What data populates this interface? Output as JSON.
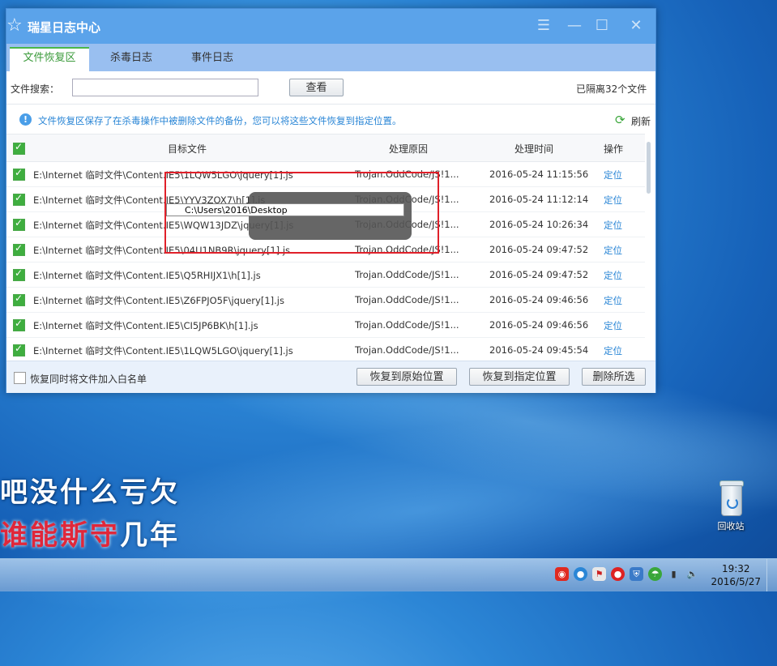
{
  "window": {
    "title": "瑞星日志中心",
    "tabs": [
      {
        "label": "文件恢复区",
        "active": true
      },
      {
        "label": "杀毒日志",
        "active": false
      },
      {
        "label": "事件日志",
        "active": false
      }
    ],
    "search_label": "文件搜索：",
    "search_value": "",
    "search_button": "查看",
    "isolated_count": "已隔离32个文件",
    "info_text": "文件恢复区保存了在杀毒操作中被删除文件的备份，您可以将这些文件恢复到指定位置。",
    "refresh_label": "刷新",
    "columns": [
      "目标文件",
      "处理原因",
      "处理时间",
      "操作"
    ],
    "rows": [
      {
        "file": "E:\\Internet 临时文件\\Content.IE5\\1LQW5LGO\\jquery[1].js",
        "reason": "Trojan.OddCode/JS!1...",
        "time": "2016-05-24 11:15:56",
        "action": "定位"
      },
      {
        "file": "E:\\Internet 临时文件\\Content.IE5\\YYV3ZOX7\\h[1].js",
        "reason": "Trojan.OddCode/JS!1...",
        "time": "2016-05-24 11:12:14",
        "action": "定位"
      },
      {
        "file": "E:\\Internet 临时文件\\Content.IE5\\WQW13JDZ\\jquery[1].js",
        "reason": "Trojan.OddCode/JS!1...",
        "time": "2016-05-24 10:26:34",
        "action": "定位"
      },
      {
        "file": "E:\\Internet 临时文件\\Content.IE5\\04U1NB9R\\jquery[1].js",
        "reason": "Trojan.OddCode/JS!1...",
        "time": "2016-05-24 09:47:52",
        "action": "定位"
      },
      {
        "file": "E:\\Internet 临时文件\\Content.IE5\\Q5RHIJX1\\h[1].js",
        "reason": "Trojan.OddCode/JS!1...",
        "time": "2016-05-24 09:47:52",
        "action": "定位"
      },
      {
        "file": "E:\\Internet 临时文件\\Content.IE5\\Z6FPJO5F\\jquery[1].js",
        "reason": "Trojan.OddCode/JS!1...",
        "time": "2016-05-24 09:46:56",
        "action": "定位"
      },
      {
        "file": "E:\\Internet 临时文件\\Content.IE5\\CI5JP6BK\\h[1].js",
        "reason": "Trojan.OddCode/JS!1...",
        "time": "2016-05-24 09:46:56",
        "action": "定位"
      },
      {
        "file": "E:\\Internet 临时文件\\Content.IE5\\1LQW5LGO\\jquery[1].js",
        "reason": "Trojan.OddCode/JS!1...",
        "time": "2016-05-24 09:45:54",
        "action": "定位"
      }
    ],
    "whitelist_label": "恢复同时将文件加入白名单",
    "restore_original": "恢复到原始位置",
    "restore_to": "恢复到指定位置",
    "delete_selected": "删除所选"
  },
  "overlay": {
    "toast_text": "",
    "tooltip_path": "C:\\Users\\2016\\Desktop"
  },
  "desktop": {
    "lyric_line1": "吧没什么亏欠",
    "lyric_line2_red": "谁能斯守",
    "lyric_line2_white": "几年",
    "recycle_bin": "回收站"
  },
  "taskbar": {
    "time": "19:32",
    "date": "2016/5/27"
  },
  "colors": {
    "accent": "#5ba3ea",
    "check_green": "#3fae3f",
    "link": "#2a86d6",
    "highlight": "#e0202a"
  }
}
